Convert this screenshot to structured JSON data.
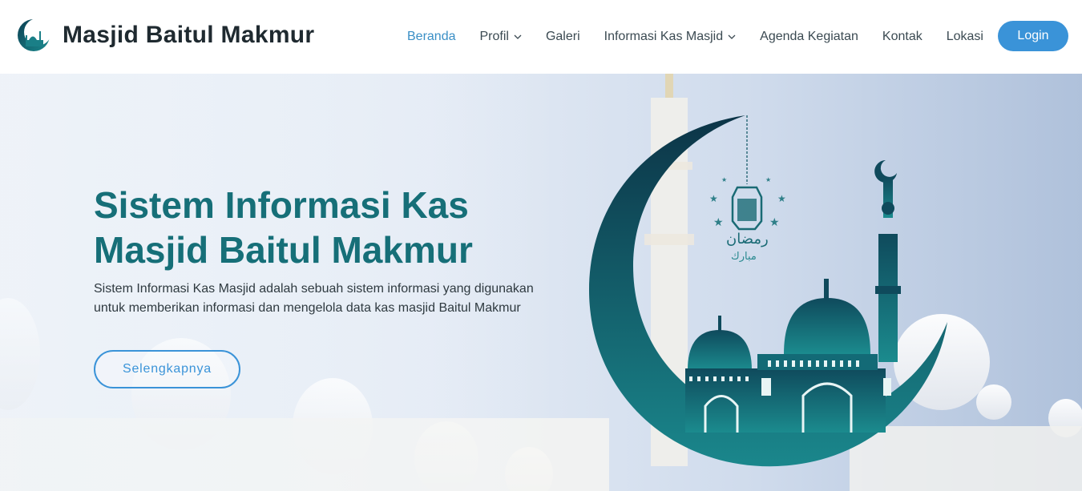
{
  "header": {
    "brand_name": "Masjid Baitul Makmur",
    "nav": [
      {
        "label": "Beranda",
        "active": true,
        "dropdown": false
      },
      {
        "label": "Profil",
        "active": false,
        "dropdown": true
      },
      {
        "label": "Galeri",
        "active": false,
        "dropdown": false
      },
      {
        "label": "Informasi Kas Masjid",
        "active": false,
        "dropdown": true
      },
      {
        "label": "Agenda Kegiatan",
        "active": false,
        "dropdown": false
      },
      {
        "label": "Kontak",
        "active": false,
        "dropdown": false
      },
      {
        "label": "Lokasi",
        "active": false,
        "dropdown": false
      }
    ],
    "login_label": "Login"
  },
  "hero": {
    "title_line1": "Sistem Informasi Kas",
    "title_line2": "Masjid Baitul Makmur",
    "description": "Sistem Informasi Kas Masjid adalah sebuah sistem informasi yang digunakan untuk memberikan informasi dan mengelola data kas masjid Baitul Makmur",
    "button_label": "Selengkapnya",
    "art_text_line1": "رمضان",
    "art_text_line2": "مبارك"
  },
  "colors": {
    "accent": "#3a93d8",
    "brand_teal": "#166f78",
    "crescent_dark": "#0d4a5a"
  },
  "icons": {
    "logo": "mosque-crescent-logo-icon",
    "dropdown": "chevron-down-icon",
    "hero_art": "ramadan-crescent-mosque-illustration"
  }
}
